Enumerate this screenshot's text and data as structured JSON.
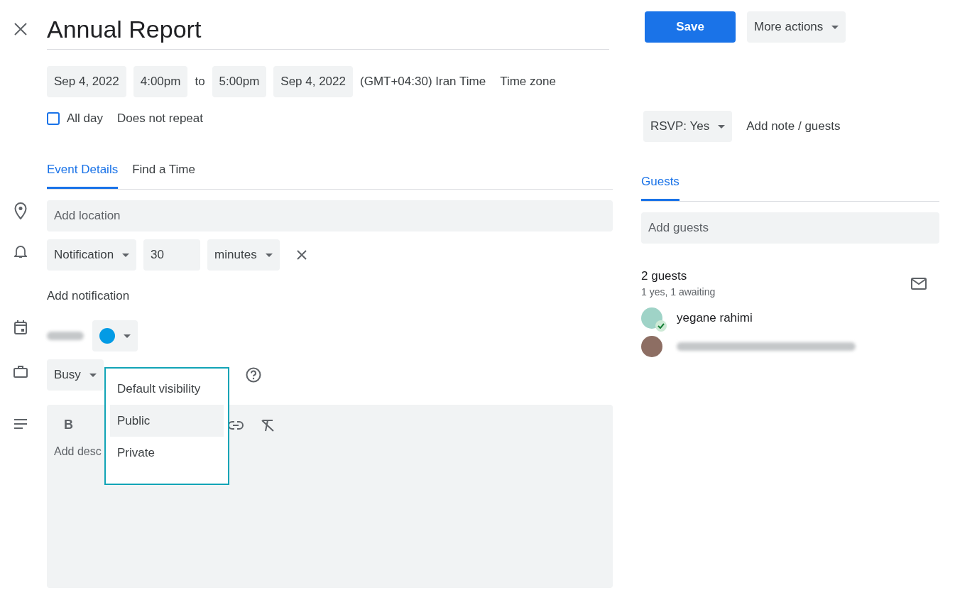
{
  "title": "Annual Report",
  "start_date": "Sep 4, 2022",
  "start_time": "4:00pm",
  "to": "to",
  "end_time": "5:00pm",
  "end_date": "Sep 4, 2022",
  "timezone_label": "(GMT+04:30) Iran Time",
  "timezone_button": "Time zone",
  "all_day": {
    "label": "All day",
    "checked": false
  },
  "repeat": "Does not repeat",
  "tabs": [
    {
      "label": "Event Details",
      "selected": true
    },
    {
      "label": "Find a Time",
      "selected": false
    }
  ],
  "location": {
    "placeholder": "Add location"
  },
  "notification": {
    "type": "Notification",
    "value": "30",
    "unit": "minutes"
  },
  "add_notification": "Add notification",
  "calendar": {
    "color": "#039be5"
  },
  "availability": "Busy",
  "visibility_menu": [
    {
      "label": "Default visibility",
      "selected": false
    },
    {
      "label": "Public",
      "selected": true
    },
    {
      "label": "Private",
      "selected": false
    }
  ],
  "description": {
    "toolbar_bold": "B",
    "placeholder": "Add desc"
  },
  "save": "Save",
  "more_actions": "More actions",
  "rsvp": "RSVP: Yes",
  "add_note": "Add note / guests",
  "guests_tab": {
    "label": "Guests",
    "selected": true
  },
  "add_guests": {
    "placeholder": "Add guests"
  },
  "guest_count": "2 guests",
  "guest_summary": "1 yes, 1 awaiting",
  "guests": [
    {
      "name": "yegane rahimi",
      "kind": "named",
      "accepted": true
    },
    {
      "kind": "blurred",
      "accepted": false
    }
  ]
}
